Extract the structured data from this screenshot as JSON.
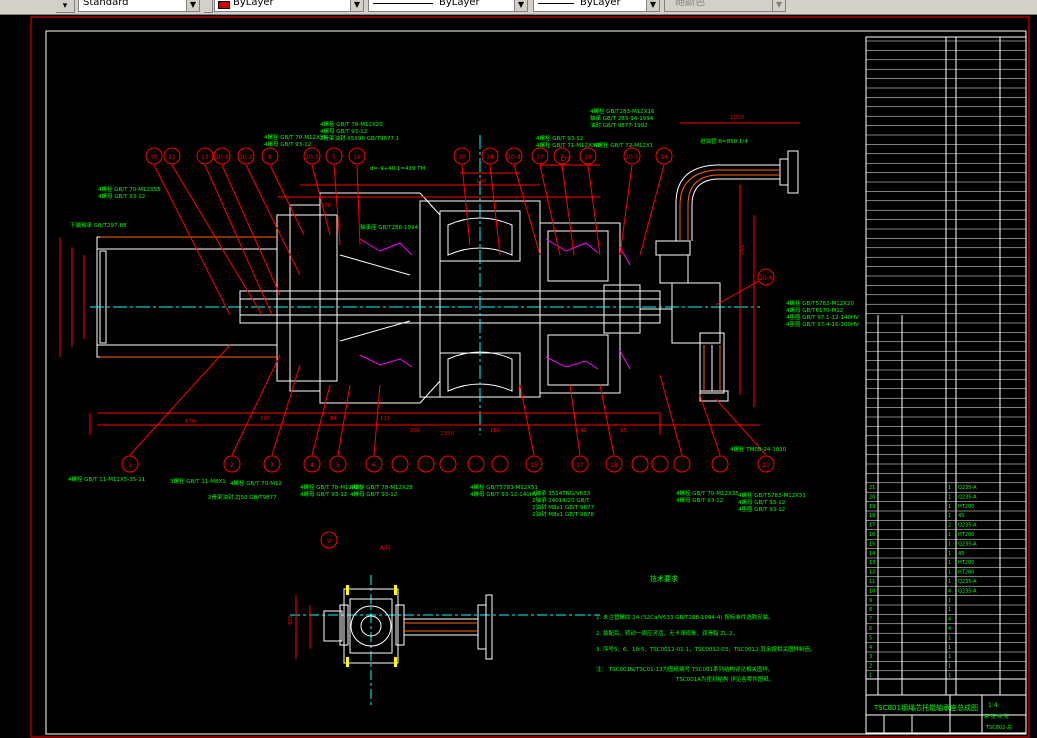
{
  "toolbar": {
    "text_style": "Standard",
    "layer_color": "ByLayer",
    "linetype": "ByLayer",
    "lineweight": "ByLayer",
    "plot_style": "随颜色",
    "accent_color": "#cc0000"
  },
  "drawing": {
    "title": "TSC801钢绳芯托辊轴承座总成图",
    "drawing_no": "TSC802-总",
    "scale": "1:4",
    "view_label": "A向",
    "sheet_label": "第 张 共 张",
    "tech_title": "技术要求",
    "tech_notes": [
      "1. 未注管螺纹 24 (S2Ca/V633 GB/T288-1994-4) 按标准件选购安装。",
      "2. 装配后，转动一周应灵活，无卡滞现象，润滑脂 ZL-2。",
      "3. 序号5、6、10-5，TSC0012-01-1，TSC0012-03，TSC0012-其余按相关图样制造。",
      "注： TSC001N/TSC01-13为图纸编号 TSC001系列结构详见相关图样。",
      "TSC001A为密封结构 详见各零件图纸。"
    ],
    "top_labels": [
      "4螺栓 GB/T 93-12",
      "4螺栓 GB/T 78-M12X20",
      "4螺母 GB/T 93-12",
      "4螺栓 GB/T 78-M12X45"
    ],
    "colors": {
      "frame": "#ff0000",
      "outline": "#ffffff",
      "leader": "#ff0000",
      "dim": "#ff0000",
      "text_green": "#00ff00",
      "text_yellow": "#ffff00",
      "centerline": "#00ffff",
      "hatch": "#ff6600",
      "seal": "#ff00ff"
    }
  },
  "bom": {
    "rows": [
      [
        "1",
        "1",
        ""
      ],
      [
        "2",
        "1",
        ""
      ],
      [
        "3",
        "1",
        ""
      ],
      [
        "4",
        "1",
        ""
      ],
      [
        "5",
        "1",
        ""
      ],
      [
        "6",
        "4",
        ""
      ],
      [
        "7",
        "4",
        ""
      ],
      [
        "8",
        "1",
        ""
      ],
      [
        "9",
        "1",
        ""
      ],
      [
        "10",
        "4",
        "Q235-A"
      ],
      [
        "11",
        "1",
        "Q235-A"
      ],
      [
        "12",
        "1",
        "HT200"
      ],
      [
        "13",
        "1",
        "HT200"
      ],
      [
        "14",
        "1",
        "45"
      ],
      [
        "15",
        "1",
        "Q235-A"
      ],
      [
        "16",
        "1",
        "HT200"
      ],
      [
        "17",
        "2",
        "Q235-A"
      ],
      [
        "18",
        "1",
        "45"
      ],
      [
        "19",
        "1",
        "HT200"
      ],
      [
        "20",
        "1",
        "Q235-A"
      ],
      [
        "21",
        "1",
        "Q235-A"
      ]
    ]
  }
}
